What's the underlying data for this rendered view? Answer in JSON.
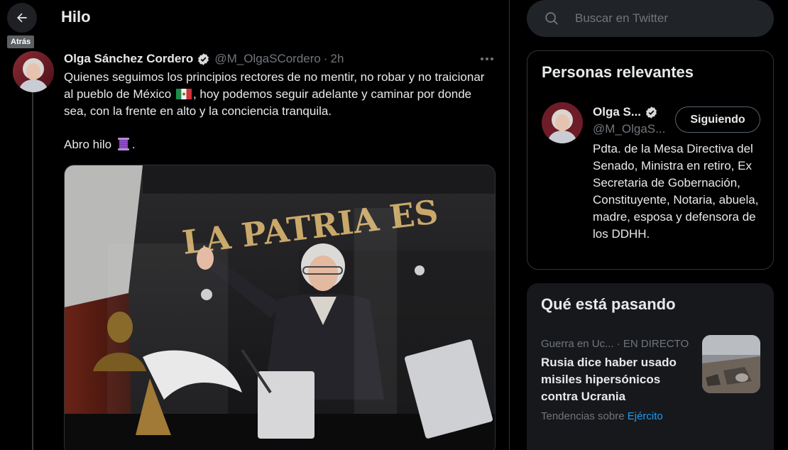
{
  "header": {
    "title": "Hilo",
    "back_tooltip": "Atrás"
  },
  "tweet": {
    "author_name": "Olga Sánchez Cordero",
    "handle": "@M_OlgaSCordero",
    "separator": "·",
    "time": "2h",
    "text_line_1": "Quienes seguimos los principios rectores de no mentir, no robar y no traicionar al pueblo de México",
    "text_line_1_flag": "🇲🇽",
    "text_line_1_cont": ", hoy podemos seguir adelante y caminar por donde sea, con la frente en alto y la conciencia tranquila.",
    "text_line_2": "Abro hilo",
    "text_line_2_end": ".",
    "photo_sign_text": "LA PATRIA ES"
  },
  "search": {
    "placeholder": "Buscar en Twitter"
  },
  "relevant_people": {
    "title": "Personas relevantes",
    "name": "Olga S...",
    "handle": "@M_OlgaS...",
    "follow_label": "Siguiendo",
    "bio": "Pdta. de la Mesa Directiva del Senado, Ministra en retiro, Ex Secretaria de Gobernación, Constituyente, Notaria, abuela, madre, esposa y defensora de los DDHH."
  },
  "whats_happening": {
    "title": "Qué está pasando",
    "trend_category": "Guerra en Uc...",
    "trend_status": "· EN DIRECTO",
    "trend_title": "Rusia dice haber usado misiles hipersónicos contra Ucrania",
    "trend_foot_prefix": "Tendencias sobre",
    "trend_foot_link": "Ejército"
  },
  "colors": {
    "background": "#000000",
    "text": "#e7e9ea",
    "muted": "#71767b",
    "accent": "#1d9bf0",
    "card": "#16181c",
    "search_bg": "#202327"
  },
  "icons": [
    "arrow-left-icon",
    "verified-badge-icon",
    "more-options-icon",
    "search-icon",
    "mexico-flag-icon",
    "thread-spool-icon"
  ]
}
